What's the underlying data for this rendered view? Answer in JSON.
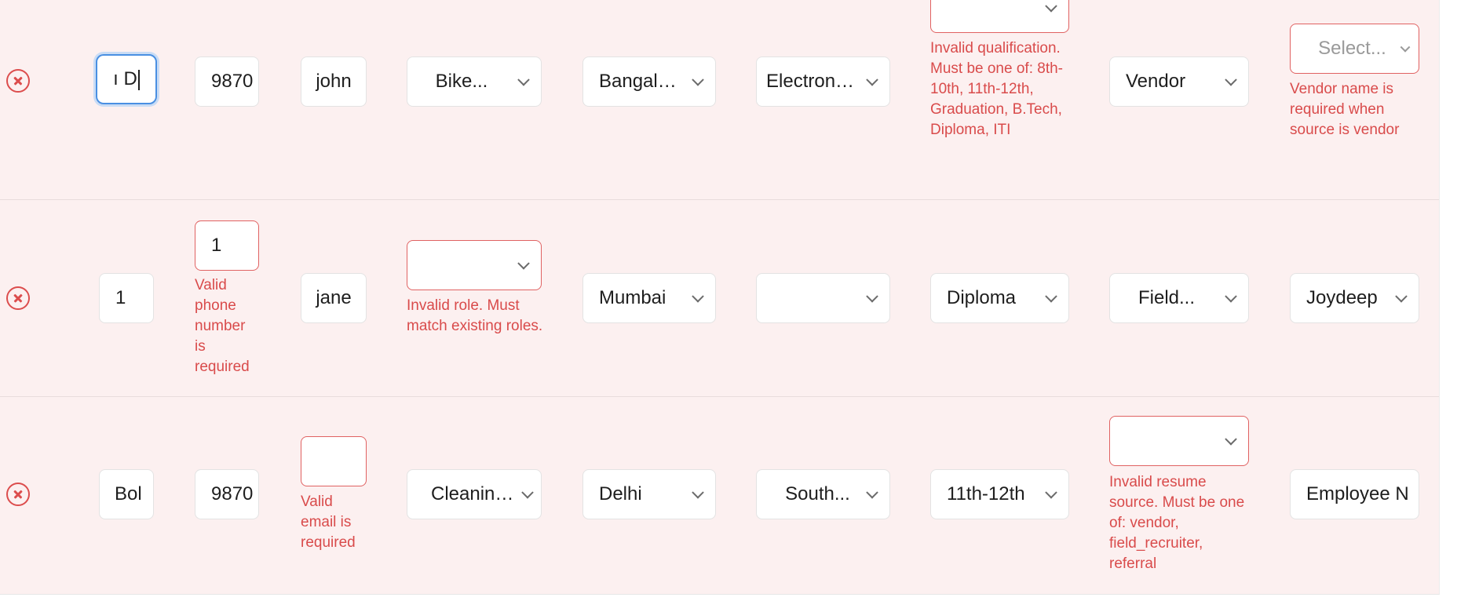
{
  "rows": [
    {
      "name_value": "ı D",
      "phone_value": "9870",
      "email_value": "john",
      "role_value": "Bike...",
      "city_value": "Bangalore",
      "category_value": "Electroni...",
      "qualification_value": "",
      "qualification_error": "Invalid qualification. Must be one of: 8th-10th, 11th-12th, Graduation, B.Tech, Diploma, ITI",
      "source_value": "Vendor",
      "vendor_value": "Select...",
      "vendor_error": "Vendor name is required when source is vendor"
    },
    {
      "name_value": "1",
      "phone_value": "1",
      "phone_error": "Valid phone number is required",
      "email_value": "jane",
      "role_value": "",
      "role_error": "Invalid role. Must match existing roles.",
      "city_value": "Mumbai",
      "category_value": "",
      "qualification_value": "Diploma",
      "source_value": "Field...",
      "vendor_value": "Joydeep"
    },
    {
      "name_value": "Bol",
      "phone_value": "9870",
      "email_value": "",
      "email_error": "Valid email is required",
      "role_value": "Cleaning...",
      "city_value": "Delhi",
      "category_value": "South...",
      "qualification_value": "11th-12th",
      "source_value": "",
      "source_error": "Invalid resume source. Must be one of: vendor, field_recruiter, referral",
      "vendor_value": "Employee N"
    }
  ],
  "icons": {
    "delete": "close-circle-icon",
    "dropdown": "chevron-down-icon"
  },
  "colors": {
    "row_background": "#fcf0f0",
    "error": "#d94b4b",
    "focus_ring": "#4a8fe2"
  }
}
